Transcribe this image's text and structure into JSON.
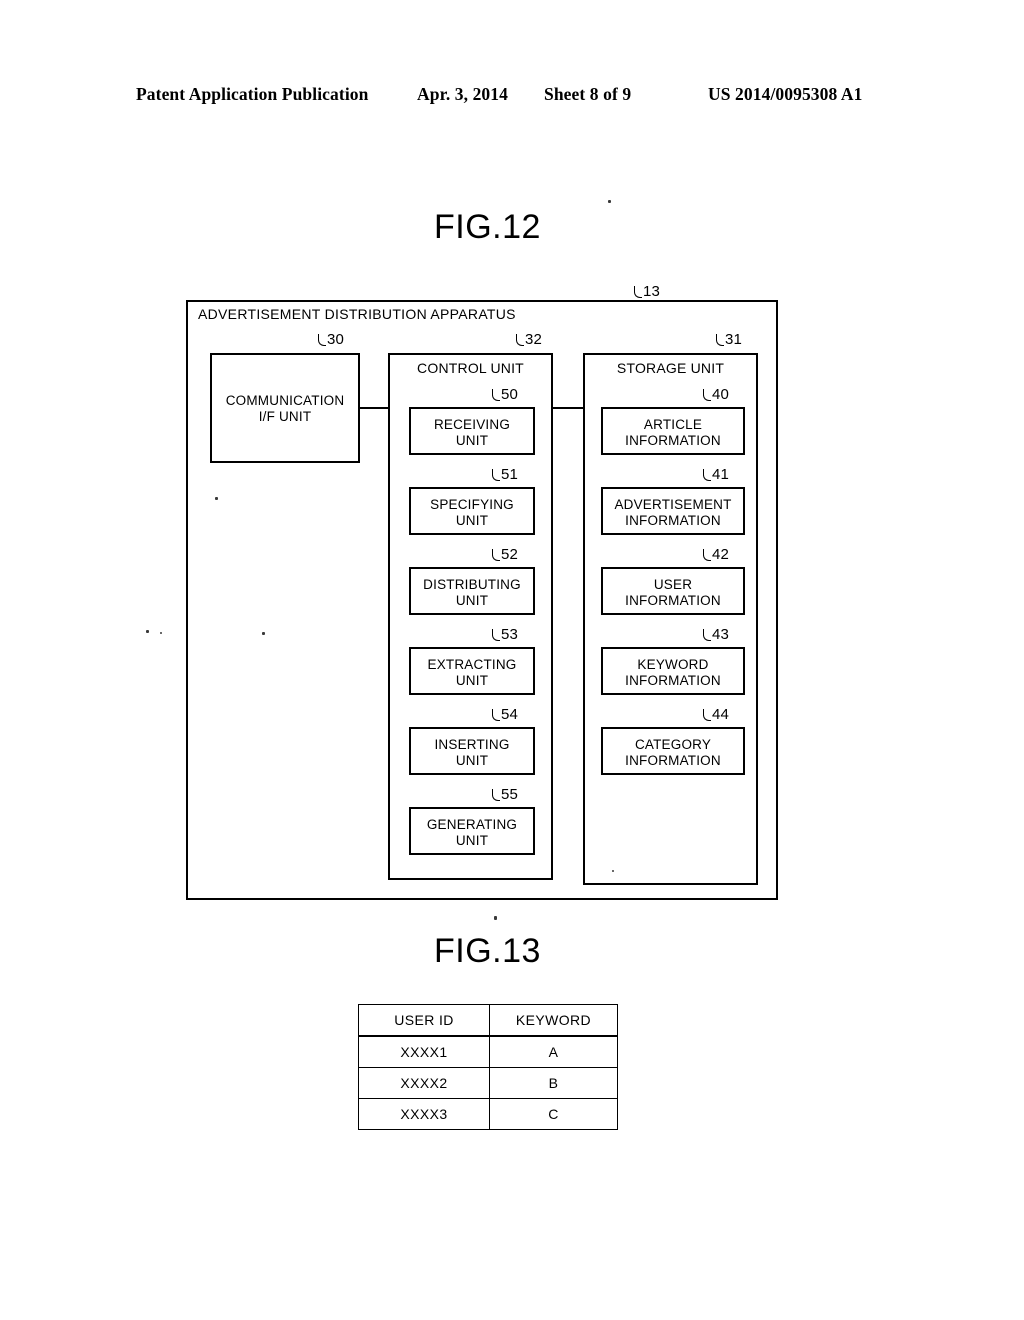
{
  "header": {
    "publication": "Patent Application Publication",
    "date": "Apr. 3, 2014",
    "sheet": "Sheet 8 of 9",
    "patent_number": "US 2014/0095308 A1"
  },
  "figures": {
    "fig12": {
      "title": "FIG.12",
      "apparatus": {
        "label": "ADVERTISEMENT DISTRIBUTION APPARATUS",
        "ref": "13"
      },
      "comm_unit": {
        "label": "COMMUNICATION\nI/F UNIT",
        "ref": "30"
      },
      "control_unit": {
        "label": "CONTROL UNIT",
        "ref": "32",
        "units": [
          {
            "label": "RECEIVING\nUNIT",
            "ref": "50"
          },
          {
            "label": "SPECIFYING\nUNIT",
            "ref": "51"
          },
          {
            "label": "DISTRIBUTING\nUNIT",
            "ref": "52"
          },
          {
            "label": "EXTRACTING\nUNIT",
            "ref": "53"
          },
          {
            "label": "INSERTING\nUNIT",
            "ref": "54"
          },
          {
            "label": "GENERATING\nUNIT",
            "ref": "55"
          }
        ]
      },
      "storage_unit": {
        "label": "STORAGE UNIT",
        "ref": "31",
        "items": [
          {
            "label": "ARTICLE\nINFORMATION",
            "ref": "40"
          },
          {
            "label": "ADVERTISEMENT\nINFORMATION",
            "ref": "41"
          },
          {
            "label": "USER\nINFORMATION",
            "ref": "42"
          },
          {
            "label": "KEYWORD\nINFORMATION",
            "ref": "43"
          },
          {
            "label": "CATEGORY\nINFORMATION",
            "ref": "44"
          }
        ]
      }
    },
    "fig13": {
      "title": "FIG.13",
      "table": {
        "columns": [
          "USER ID",
          "KEYWORD"
        ],
        "rows": [
          [
            "XXXX1",
            "A"
          ],
          [
            "XXXX2",
            "B"
          ],
          [
            "XXXX3",
            "C"
          ]
        ]
      }
    }
  },
  "colors": {
    "ink": "#000000",
    "paper": "#ffffff"
  }
}
